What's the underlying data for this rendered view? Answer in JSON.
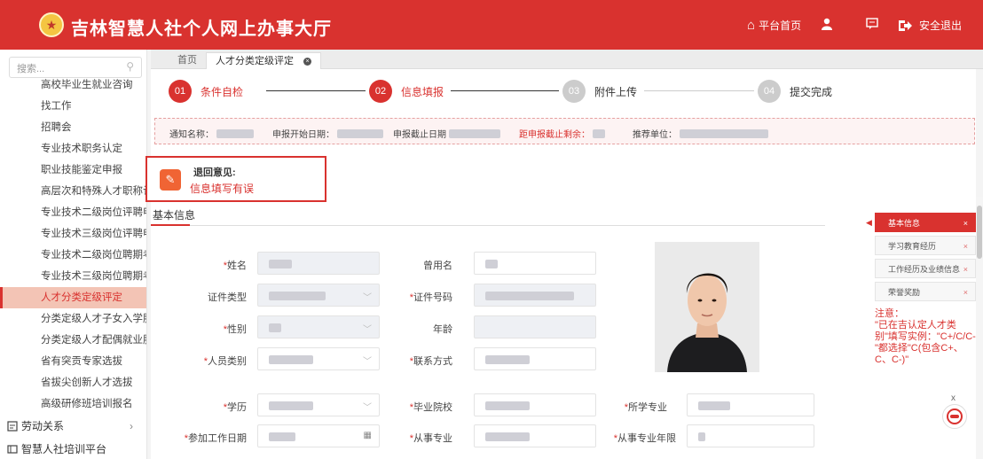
{
  "header": {
    "title": "吉林智慧人社个人网上办事大厅",
    "logo_char": "★",
    "home_label": "平台首页",
    "logout_label": "安全退出",
    "home_icon_glyph": "⌂",
    "user_icon_glyph": "👤",
    "msg_icon_glyph": "▭",
    "logout_icon_glyph": "⇥",
    "brand_color": "#d9322f"
  },
  "sidebar": {
    "search_placeholder": "搜索...",
    "items": [
      {
        "label": "高校毕业生就业咨询",
        "active": false
      },
      {
        "label": "找工作",
        "active": false
      },
      {
        "label": "招聘会",
        "active": false
      },
      {
        "label": "专业技术职务认定",
        "active": false
      },
      {
        "label": "职业技能鉴定申报",
        "active": false
      },
      {
        "label": "高层次和特殊人才职称认定",
        "active": false
      },
      {
        "label": "专业技术二级岗位评聘申报",
        "active": false
      },
      {
        "label": "专业技术三级岗位评聘申报",
        "active": false
      },
      {
        "label": "专业技术二级岗位聘期考核",
        "active": false
      },
      {
        "label": "专业技术三级岗位聘期考核",
        "active": false
      },
      {
        "label": "人才分类定级评定",
        "active": true
      },
      {
        "label": "分类定级人才子女入学服务",
        "active": false
      },
      {
        "label": "分类定级人才配偶就业服务",
        "active": false
      },
      {
        "label": "省有突贡专家选拔",
        "active": false
      },
      {
        "label": "省拔尖创新人才选拔",
        "active": false
      },
      {
        "label": "高级研修班培训报名",
        "active": false
      }
    ],
    "groups": [
      {
        "label": "劳动关系",
        "arrow": "›"
      },
      {
        "label": "智慧人社培训平台",
        "arrow": ""
      }
    ]
  },
  "tabs": [
    {
      "label": "首页"
    },
    {
      "label": "人才分类定级评定"
    }
  ],
  "steps": [
    {
      "num": "01",
      "label": "条件自检",
      "done": true
    },
    {
      "num": "02",
      "label": "信息填报",
      "done": true
    },
    {
      "num": "03",
      "label": "附件上传",
      "done": false
    },
    {
      "num": "04",
      "label": "提交完成",
      "done": false
    }
  ],
  "notice": {
    "name_label": "通知名称：",
    "start_label": "申报开始日期：",
    "end_label": "申报截止日期",
    "remain_label": "距申报截止剩余：",
    "unit_label": "推荐单位："
  },
  "return_box": {
    "title": "退回意见:",
    "text": "信息填写有误"
  },
  "section": {
    "title": "基本信息"
  },
  "form": {
    "name": "姓名",
    "former_name": "曾用名",
    "id_type": "证件类型",
    "id_number": "证件号码",
    "gender": "性别",
    "age": "年龄",
    "person_type": "人员类别",
    "contact": "联系方式",
    "education": "学历",
    "school": "毕业院校",
    "major": "所学专业",
    "work_date": "参加工作日期",
    "profession": "从事专业",
    "profession_years": "从事专业年限",
    "req": "*"
  },
  "right_panel": {
    "tabs": [
      "基本信息",
      "学习教育经历",
      "工作经历及业绩信息",
      "荣誉奖励"
    ],
    "note_title": "注意：",
    "note_body": "\"已在吉认定人才类别\"填写实例：\"C+/C/C-\"都选择\"C(包含C+、C、C-)\""
  }
}
